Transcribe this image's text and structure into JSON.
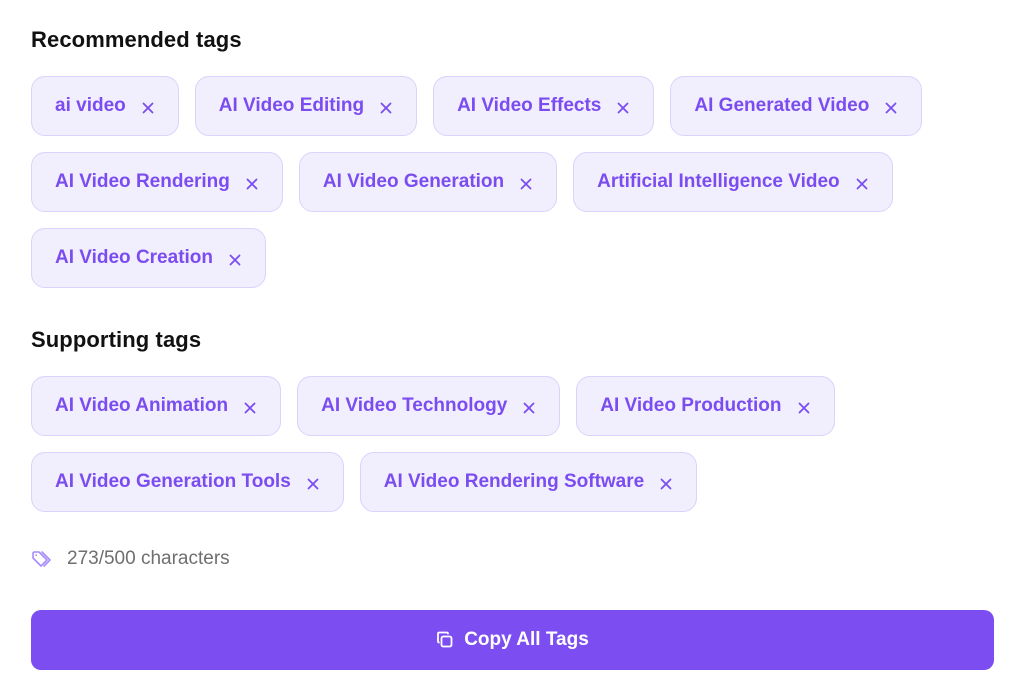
{
  "recommended": {
    "title": "Recommended tags",
    "tags": [
      {
        "label": "ai video"
      },
      {
        "label": "AI Video Editing"
      },
      {
        "label": "AI Video Effects"
      },
      {
        "label": "AI Generated Video"
      },
      {
        "label": "AI Video Rendering"
      },
      {
        "label": "AI Video Generation"
      },
      {
        "label": "Artificial Intelligence Video"
      },
      {
        "label": "AI Video Creation"
      }
    ]
  },
  "supporting": {
    "title": "Supporting tags",
    "tags": [
      {
        "label": "AI Video Animation"
      },
      {
        "label": "AI Video Technology"
      },
      {
        "label": "AI Video Production"
      },
      {
        "label": "AI Video Generation Tools"
      },
      {
        "label": "AI Video Rendering Software"
      }
    ]
  },
  "counter": {
    "icon": "tags-icon",
    "text": "273/500 characters"
  },
  "copy_button": {
    "icon": "copy-icon",
    "label": "Copy All Tags"
  },
  "colors": {
    "accent": "#7c4df0",
    "tag_bg": "#f1eefe",
    "tag_border": "#dcd2fb",
    "tag_text": "#7b4df0"
  }
}
